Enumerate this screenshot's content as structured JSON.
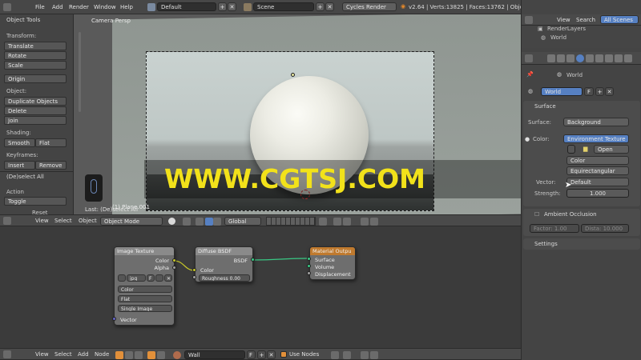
{
  "topbar": {
    "menus": [
      "File",
      "Add",
      "Render",
      "Window",
      "Help"
    ],
    "screen_layout": "Default",
    "scene": "Scene",
    "engine": "Cycles Render",
    "stats": "v2.64 | Verts:13825 | Faces:13762 | Objects:0/6 | Lamps:0/0 | Mem:29.26M (33.34M)"
  },
  "toolshelf": {
    "title": "Object Tools",
    "transform_label": "Transform:",
    "translate": "Translate",
    "rotate": "Rotate",
    "scale": "Scale",
    "origin": "Origin",
    "object_label": "Object:",
    "duplicate": "Duplicate Objects",
    "delete": "Delete",
    "join": "Join",
    "shading_label": "Shading:",
    "smooth": "Smooth",
    "flat": "Flat",
    "keyframes_label": "Keyframes:",
    "insert": "Insert",
    "remove": "Remove",
    "deselect_title": "(De)select All",
    "action_label": "Action",
    "action_value": "Toggle",
    "reset": "Reset"
  },
  "viewport": {
    "camera_label": "Camera Persp",
    "last_op": "Last: (De)select All",
    "object_name": "(1) Plane.001"
  },
  "viewport_header": {
    "view": "View",
    "select": "Select",
    "object": "Object",
    "mode": "Object Mode",
    "orientation": "Global"
  },
  "watermark": "WWW.CGTSJ.COM",
  "node_editor": {
    "nodes": {
      "image_texture": {
        "title": "Image Texture",
        "out_color": "Color",
        "out_alpha": "Alpha",
        "file": "jpg",
        "file_flag": "F",
        "color_space": "Color",
        "projection": "Flat",
        "source": "Single Image",
        "in_vector": "Vector"
      },
      "diffuse": {
        "title": "Diffuse BSDF",
        "out_bsdf": "BSDF",
        "in_color": "Color",
        "roughness": "Roughness 0.00"
      },
      "output": {
        "title": "Material Outpu",
        "surface": "Surface",
        "volume": "Volume",
        "displacement": "Displacement"
      }
    }
  },
  "node_header": {
    "view": "View",
    "select": "Select",
    "add": "Add",
    "node": "Node",
    "material": "Wall",
    "material_flag": "F",
    "use_nodes": "Use Nodes"
  },
  "outliner": {
    "view": "View",
    "search": "Search",
    "all_scenes": "All Scenes",
    "item_renderlayers": "RenderLayers",
    "item_world": "World"
  },
  "properties": {
    "breadcrumb": "World",
    "world_name": "World",
    "world_flag": "F",
    "surface_title": "Surface",
    "surface_label": "Surface:",
    "surface_value": "Background",
    "color_label": "Color:",
    "color_value": "Environment Texture",
    "open": "Open",
    "color_space": "Color",
    "projection": "Equirectangular",
    "vector_label": "Vector:",
    "vector_value": "Default",
    "strength_label": "Strength:",
    "strength_value": "1.000",
    "ao_title": "Ambient Occlusion",
    "factor": "Factor: 1.00",
    "distance": "Dista: 10.000",
    "settings_title": "Settings"
  },
  "colors": {
    "accent_blue": "#5680c2",
    "node_output_header": "#c07a2e",
    "socket_yellow": "#c7c729",
    "socket_green": "#39c884",
    "socket_gray": "#a1a1a1",
    "socket_blue": "#6363c7",
    "watermark": "#f2e21a"
  }
}
